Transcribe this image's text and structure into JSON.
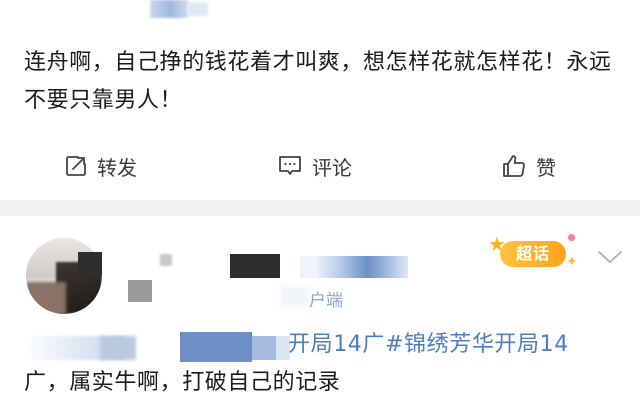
{
  "post1": {
    "text": "连舟啊，自己挣的钱花着才叫爽，想怎样花就怎样花！永远不要只靠男人！",
    "actions": {
      "repost_label": "转发",
      "comment_label": "评论",
      "like_label": "赞"
    }
  },
  "post2": {
    "client_text": "户端",
    "supertopic_badge": "超话",
    "text_line1_hashtag": "开局14广#锦绣芳华开局14",
    "text_line2": "广，属实牛啊，打破自己的记录"
  },
  "colors": {
    "link_blue": "#4f7cc2",
    "badge_orange": "#ffa31a",
    "divider": "#f2f2f2"
  },
  "icons": {
    "repost": "repost-icon",
    "comment": "comment-icon",
    "like": "thumbs-up-icon",
    "more": "chevron-down-icon",
    "badge": "supertopic-badge"
  }
}
